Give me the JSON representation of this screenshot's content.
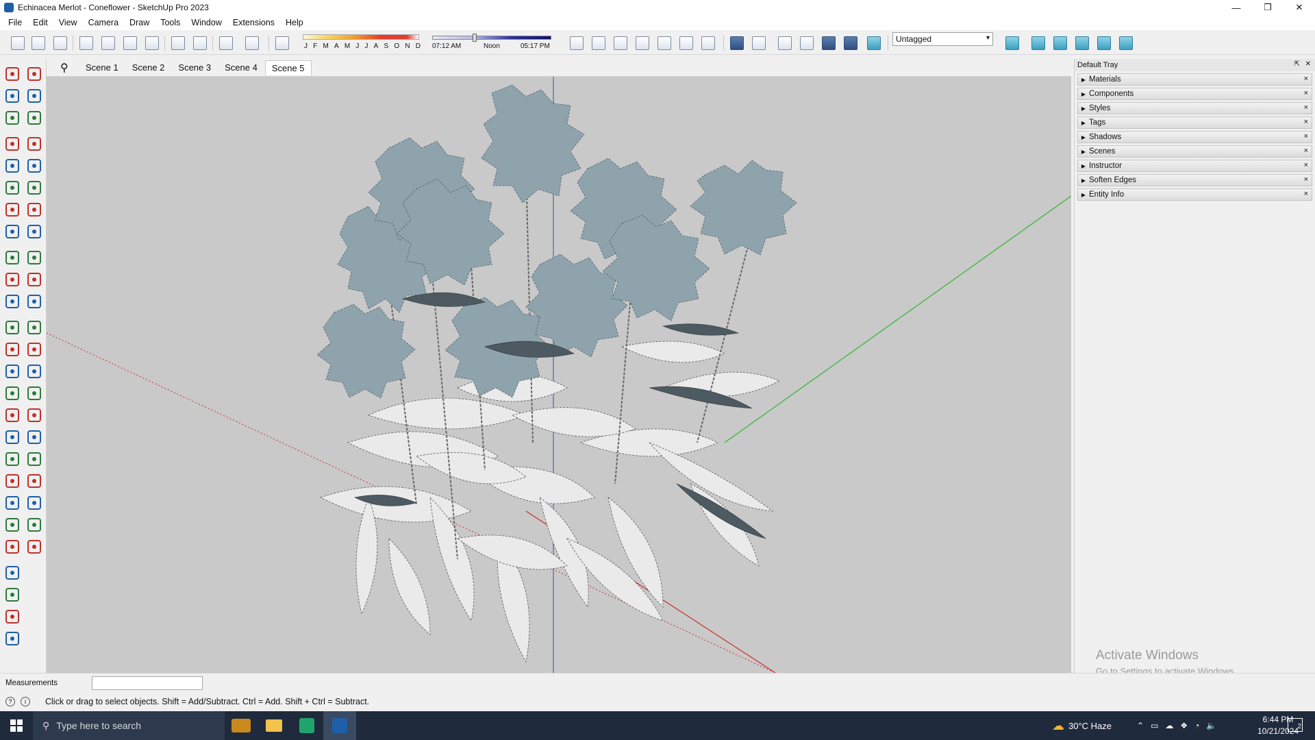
{
  "window": {
    "title": "Echinacea Merlot - Coneflower - SketchUp Pro 2023",
    "minimize": "—",
    "restore": "❐",
    "close": "✕"
  },
  "menu": [
    "File",
    "Edit",
    "View",
    "Camera",
    "Draw",
    "Tools",
    "Window",
    "Extensions",
    "Help"
  ],
  "shadow": {
    "months": [
      "J",
      "F",
      "M",
      "A",
      "M",
      "J",
      "J",
      "A",
      "S",
      "O",
      "N",
      "D"
    ],
    "sunrise": "07:12 AM",
    "noon": "Noon",
    "sunset": "05:17 PM",
    "time_position": 0.33
  },
  "tag_select": {
    "value": "Untagged"
  },
  "scenes": {
    "search_icon": "⚲",
    "tabs": [
      "Scene 1",
      "Scene 2",
      "Scene 3",
      "Scene 4",
      "Scene 5"
    ],
    "active": "Scene 5"
  },
  "tray": {
    "title": "Default Tray",
    "items": [
      "Materials",
      "Components",
      "Styles",
      "Tags",
      "Shadows",
      "Scenes",
      "Instructor",
      "Soften Edges",
      "Entity Info"
    ],
    "pin": "⇱",
    "close": "✕",
    "item_close": "×"
  },
  "activation": {
    "line1": "Activate Windows",
    "line2": "Go to Settings to activate Windows."
  },
  "measurements": {
    "label": "Measurements",
    "value": ""
  },
  "status": {
    "text": "Click or drag to select objects. Shift = Add/Subtract. Ctrl = Add. Shift + Ctrl = Subtract."
  },
  "taskbar": {
    "search_placeholder": "Type here to search",
    "weather": "30°C  Haze",
    "time": "6:44 PM",
    "date": "10/21/2024",
    "notification_count": "2"
  },
  "colors": {
    "viewport": "#c9c9c9",
    "axis_red": "#cc2a2a",
    "axis_green": "#2fb52f",
    "axis_blue": "#3a4db0",
    "flower": "#8fa3ad",
    "leaf": "#e8e8e8",
    "taskbar": "#1f2a3c"
  }
}
